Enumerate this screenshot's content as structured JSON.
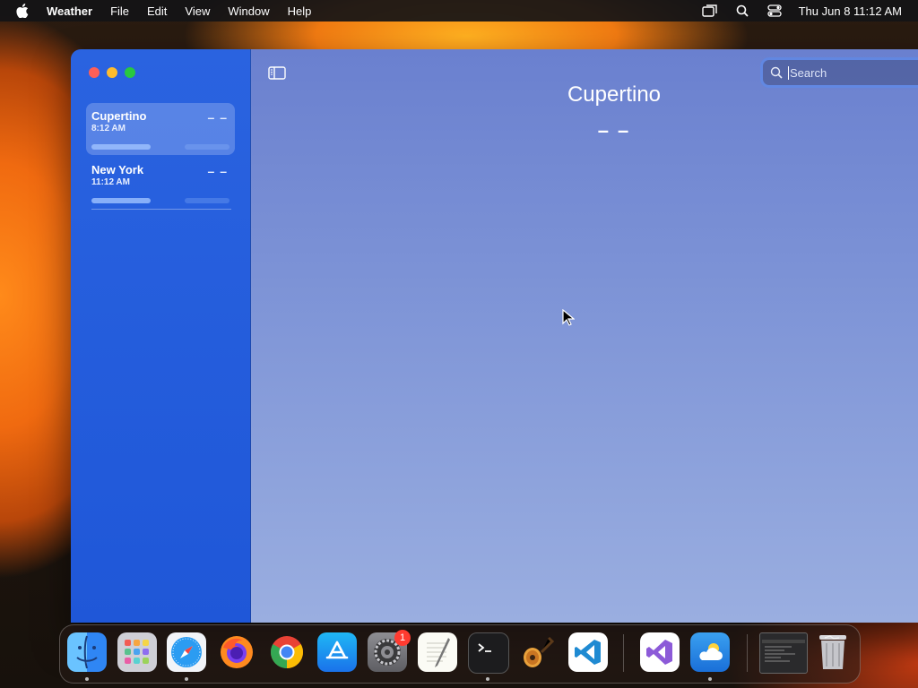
{
  "menubar": {
    "app_name": "Weather",
    "items": [
      "File",
      "Edit",
      "View",
      "Window",
      "Help"
    ],
    "clock": "Thu Jun 8  11:12 AM"
  },
  "sidebar": {
    "cities": [
      {
        "name": "Cupertino",
        "time": "8:12 AM",
        "temp": "– –",
        "selected": true
      },
      {
        "name": "New York",
        "time": "11:12 AM",
        "temp": "– –",
        "selected": false
      }
    ]
  },
  "main": {
    "title": "Cupertino",
    "temp": "– –"
  },
  "search": {
    "placeholder": "Search",
    "value": ""
  },
  "dock": {
    "apps": [
      "finder-icon",
      "launchpad-icon",
      "safari-icon",
      "firefox-icon",
      "chrome-icon",
      "app-store-icon",
      "system-settings-icon",
      "textedit-icon",
      "terminal-icon",
      "garageband-icon",
      "vscode-icon",
      "visual-studio-icon",
      "weather-icon",
      "window-preview-icon",
      "trash-icon"
    ],
    "settings_badge": "1"
  },
  "colors": {
    "sidebar": "#2a63e0",
    "main_top": "#6a80cf",
    "close": "#fe5f57",
    "minimize": "#febc2e",
    "maximize": "#28c840"
  }
}
